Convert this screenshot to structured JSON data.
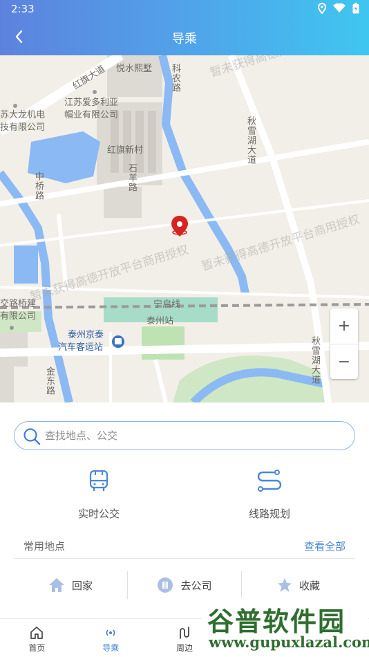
{
  "status_bar": {
    "time": "2:33"
  },
  "header": {
    "title": "导乘"
  },
  "map": {
    "labels": {
      "yueshui": "悦水熙墅",
      "hongqi_road": "红旗大道",
      "jiangsu_aiduoli_1": "江苏爱多利亚",
      "jiangsu_aiduoli_2": "帽业有限公司",
      "dalong_1": "苏大龙机电",
      "dalong_2": "技有限公司",
      "hongqi_village": "红旗新村",
      "shiyang": "石羊路",
      "kenong": "科农路",
      "qiuxue": "秋雪湖大道",
      "zhongqiao": "中桥路",
      "ningqi": "宁启线",
      "taizhou_station": "泰州站",
      "jingtai_1": "泰州京泰",
      "jingtai_2": "汽车客运站",
      "jiaolu_1": "交路桥建",
      "jiaolu_2": "有限公司",
      "qiuxue2": "秋雪湖大道",
      "jindong": "金东路"
    },
    "watermark": "暂未获得高德开放平台商用授权",
    "zoom_in": "+",
    "zoom_out": "−"
  },
  "search": {
    "placeholder": "查找地点、公交",
    "value": ""
  },
  "features": [
    {
      "label": "实时公交",
      "icon": "bus-icon"
    },
    {
      "label": "线路规划",
      "icon": "route-icon"
    }
  ],
  "common_places": {
    "title": "常用地点",
    "view_all": "查看全部"
  },
  "places": [
    {
      "label": "回家",
      "icon": "home-icon"
    },
    {
      "label": "去公司",
      "icon": "building-icon"
    },
    {
      "label": "收藏",
      "icon": "star-icon"
    }
  ],
  "tabs": [
    {
      "label": "首页",
      "icon": "home-tab-icon"
    },
    {
      "label": "导乘",
      "icon": "signal-tab-icon"
    },
    {
      "label": "周边",
      "icon": "nearby-tab-icon"
    }
  ],
  "overlay": {
    "brand": "谷普软件园",
    "url": "www.gupuxlazal.com"
  },
  "colors": {
    "accent": "#3d7fd8",
    "header_start": "#5d82de",
    "header_end": "#3fc6f0"
  }
}
